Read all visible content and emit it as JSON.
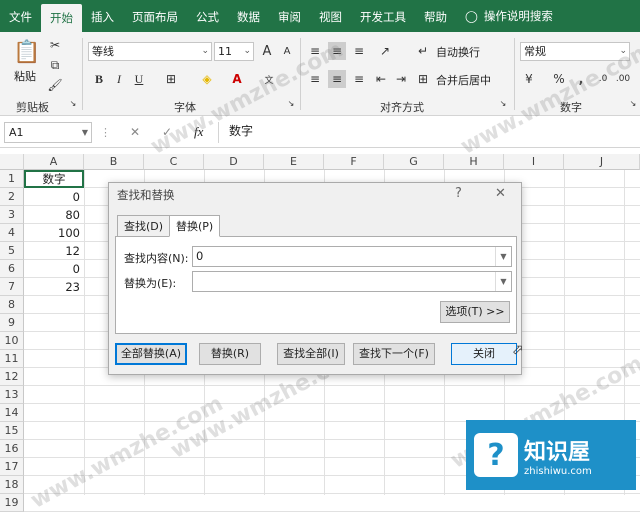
{
  "ribbon_tabs": [
    "文件",
    "开始",
    "插入",
    "页面布局",
    "公式",
    "数据",
    "审阅",
    "视图",
    "开发工具",
    "帮助"
  ],
  "tell_me": "操作说明搜索",
  "ribbon": {
    "paste_label": "粘贴",
    "font_name": "等线",
    "font_size": "11",
    "bold": "B",
    "italic": "I",
    "underline": "U",
    "grow_font": "A",
    "shrink_font": "A",
    "wrap_text": "自动换行",
    "merge_center": "合并后居中",
    "number_format": "常规",
    "percent": "%",
    "comma": ",",
    "currency": "¥",
    "groups": {
      "clipboard": "剪贴板",
      "font": "字体",
      "alignment": "对齐方式",
      "number": "数字"
    }
  },
  "formula_bar": {
    "name_box": "A1",
    "cancel": "✕",
    "enter": "✓",
    "fx": "fx",
    "content": "数字"
  },
  "columns": [
    "A",
    "B",
    "C",
    "D",
    "E",
    "F",
    "G",
    "H",
    "I",
    "J"
  ],
  "rows": [
    "1",
    "2",
    "3",
    "4",
    "5",
    "6",
    "7",
    "8",
    "9",
    "10",
    "11",
    "12",
    "13",
    "14",
    "15",
    "16",
    "17",
    "18",
    "19"
  ],
  "cells_a": [
    "数字",
    "0",
    "80",
    "100",
    "12",
    "0",
    "23"
  ],
  "dialog": {
    "title": "查找和替换",
    "help": "?",
    "close_x": "✕",
    "tab_find": "查找(D)",
    "tab_replace": "替换(P)",
    "find_label": "查找内容(N):",
    "find_value": "0",
    "replace_label": "替换为(E):",
    "replace_value": "",
    "options_button": "选项(T) >>",
    "replace_all": "全部替换(A)",
    "replace": "替换(R)",
    "find_all": "查找全部(I)",
    "find_next": "查找下一个(F)",
    "close": "关闭"
  },
  "watermark": "www.wmzhe.com",
  "logo": {
    "name": "知识屋",
    "url": "zhishiwu.com"
  }
}
